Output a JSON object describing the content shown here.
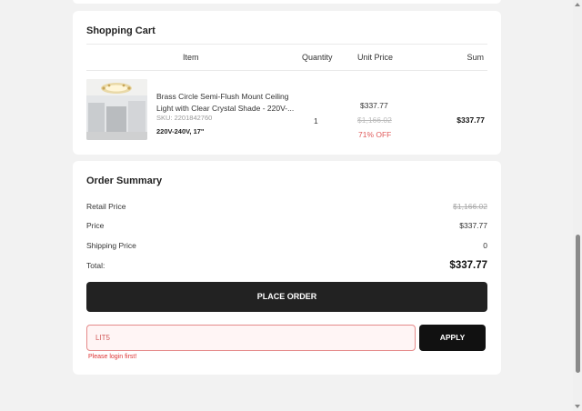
{
  "cart": {
    "title": "Shopping Cart",
    "columns": {
      "item": "Item",
      "quantity": "Quantity",
      "unit_price": "Unit Price",
      "sum": "Sum"
    },
    "items": [
      {
        "name": "Brass Circle Semi-Flush Mount Ceiling Light with Clear Crystal Shade - 220V-...",
        "sku": "SKU: 2201842760",
        "option": "220V-240V, 17\"",
        "quantity": "1",
        "price": "$337.77",
        "original_price": "$1,166.02",
        "discount": "71% OFF",
        "sum": "$337.77"
      }
    ]
  },
  "summary": {
    "title": "Order Summary",
    "retail_label": "Retail Price",
    "retail_value": "$1,166.02",
    "price_label": "Price",
    "price_value": "$337.77",
    "shipping_label": "Shipping Price",
    "shipping_value": "0",
    "total_label": "Total:",
    "total_value": "$337.77",
    "place_order_label": "PLACE ORDER",
    "coupon_value": "LIT5",
    "apply_label": "APPLY",
    "error_text": "Please login first!"
  },
  "colors": {
    "button": "#222222",
    "error": "#dd3333",
    "discount": "#e05a5a"
  }
}
